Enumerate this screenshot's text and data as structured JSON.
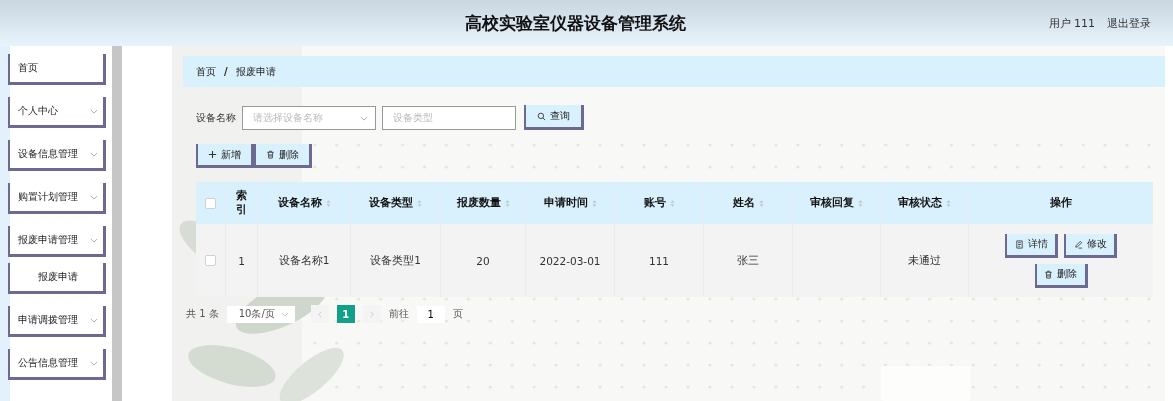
{
  "header": {
    "title": "高校实验室仪器设备管理系统",
    "user": "用户 111",
    "logout": "退出登录"
  },
  "sidebar": {
    "items": [
      {
        "label": "首页",
        "dropdown": false
      },
      {
        "label": "个人中心",
        "dropdown": true
      },
      {
        "label": "设备信息管理",
        "dropdown": true
      },
      {
        "label": "购置计划管理",
        "dropdown": true
      },
      {
        "label": "报废申请管理",
        "dropdown": true,
        "children": [
          {
            "label": "报废申请"
          }
        ]
      },
      {
        "label": "申请调拨管理",
        "dropdown": true
      },
      {
        "label": "公告信息管理",
        "dropdown": true
      }
    ]
  },
  "breadcrumb": {
    "items": [
      "首页",
      "报废申请"
    ],
    "separator": "/"
  },
  "search": {
    "label": "设备名称",
    "name_placeholder": "请选择设备名称",
    "type_placeholder": "设备类型",
    "button": "查询"
  },
  "toolbar": [
    {
      "kind": "add",
      "label": "新增"
    },
    {
      "kind": "delete",
      "label": "删除"
    }
  ],
  "table": {
    "select_all": {
      "checked": false
    },
    "columns": [
      {
        "label": "索引",
        "sortable": false
      },
      {
        "label": "设备名称",
        "sortable": true
      },
      {
        "label": "设备类型",
        "sortable": true
      },
      {
        "label": "报废数量",
        "sortable": true
      },
      {
        "label": "申请时间",
        "sortable": true
      },
      {
        "label": "账号",
        "sortable": true
      },
      {
        "label": "姓名",
        "sortable": true
      },
      {
        "label": "审核回复",
        "sortable": true
      },
      {
        "label": "审核状态",
        "sortable": true
      },
      {
        "label": "操作",
        "sortable": false
      }
    ],
    "rows": [
      {
        "checked": false,
        "cells": [
          "1",
          "设备名称1",
          "设备类型1",
          "20",
          "2022-03-01",
          "111",
          "张三",
          null,
          "未通过"
        ],
        "actions": [
          {
            "kind": "detail",
            "label": "详情"
          },
          {
            "kind": "edit",
            "label": "修改"
          },
          {
            "kind": "delete",
            "label": "删除"
          }
        ]
      }
    ]
  },
  "pagination": {
    "total": "共 1 条",
    "page_size": "10条/页",
    "pages": [
      {
        "label": "1",
        "selected": true
      }
    ],
    "goto_label": "前往",
    "goto_value": "1",
    "page_unit": "页"
  }
}
